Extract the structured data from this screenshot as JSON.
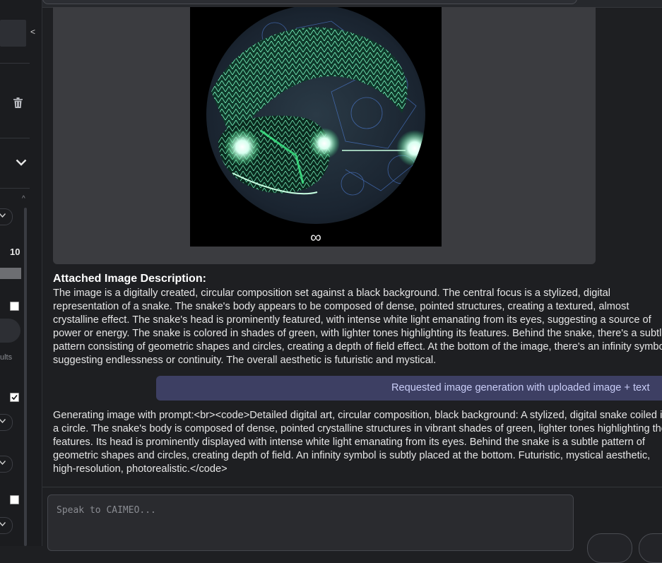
{
  "sidebar": {
    "collapse_label": "<",
    "number_value": "10",
    "partial_label": "ults",
    "checkbox_1_checked": false,
    "checkbox_2_checked": true,
    "checkbox_3_checked": false
  },
  "image": {
    "caption_symbol": "∞"
  },
  "description": {
    "title": "Attached Image Description:",
    "text": "The image is a digitally created, circular composition set against a black background. The central focus is a stylized, digital representation of a snake. The snake's body appears to be composed of dense, pointed structures, creating a textured, almost crystalline effect. The snake's head is prominently featured, with intense white light emanating from its eyes, suggesting a source of power or energy. The snake is colored in shades of green, with lighter tones highlighting its features. Behind the snake, there's a subtle pattern consisting of geometric shapes and circles, creating a depth of field effect. At the bottom of the image, there's an infinity symbol, suggesting endlessness or continuity. The overall aesthetic is futuristic and mystical."
  },
  "user_message": {
    "text": "Requested image generation with uploaded image + text"
  },
  "assistant_message": {
    "text": "Generating image with prompt:<br><code>Detailed digital art, circular composition, black background: A stylized, digital snake coiled in a circle. The snake's body is composed of dense, pointed crystalline structures in vibrant shades of green, lighter tones highlighting the features. Its head is prominently displayed with intense white light emanating from its eyes. Behind the snake is a subtle pattern of geometric shapes and circles, creating depth of field. An infinity symbol is subtly placed at the bottom. Futuristic, mystical aesthetic, high-resolution, photorealistic.</code>"
  },
  "chat_input": {
    "placeholder": "Speak to CAIMEO..."
  },
  "icons": {
    "trash": "trash-icon",
    "chevron": "chevron-down-icon",
    "infinity": "infinity-symbol"
  },
  "colors": {
    "user_bubble": "#3d3f63",
    "user_text": "#c9cdf7",
    "snake_green": "#3ef08a",
    "background": "#1e1f22"
  }
}
